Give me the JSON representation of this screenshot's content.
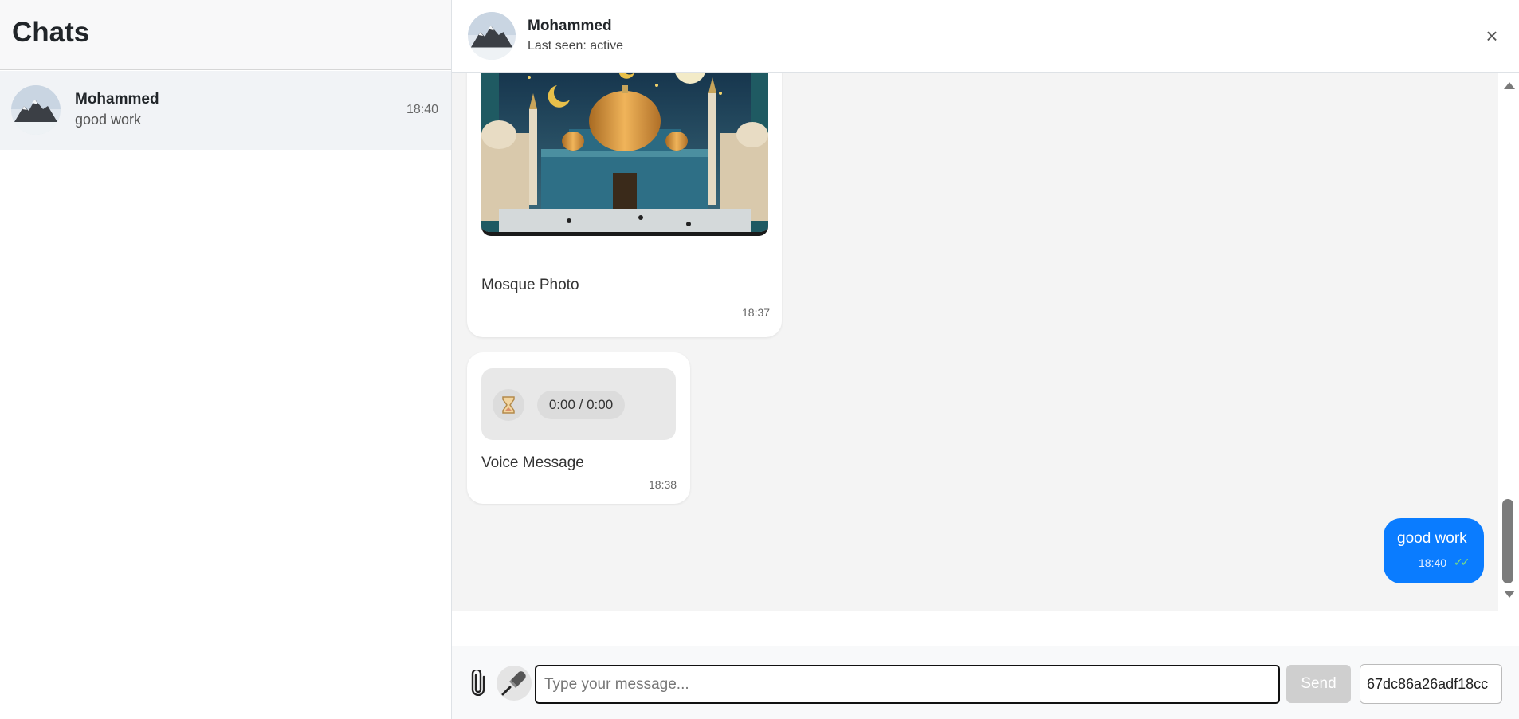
{
  "sidebar": {
    "title": "Chats",
    "chats": [
      {
        "name": "Mohammed",
        "preview": "good work",
        "time": "18:40"
      }
    ]
  },
  "header": {
    "name": "Mohammed",
    "status": "Last seen: active",
    "close_glyph": "×"
  },
  "messages": {
    "image_message": {
      "caption": "Mosque Photo",
      "time": "18:37"
    },
    "voice_message": {
      "player_time": "0:00 / 0:00",
      "caption": "Voice Message",
      "time": "18:38"
    },
    "outgoing_message": {
      "text": "good work",
      "time": "18:40",
      "status_glyph": "✓✓"
    }
  },
  "composer": {
    "placeholder": "Type your message...",
    "send_label": "Send",
    "id_value": "67dc86a26adf18cc"
  },
  "colors": {
    "accent": "#0a7cff",
    "read_check": "#7ee07e"
  },
  "icons": {
    "attach": "paperclip-icon",
    "mic": "microphone-icon",
    "close": "close-icon",
    "play": "hourglass-icon"
  }
}
